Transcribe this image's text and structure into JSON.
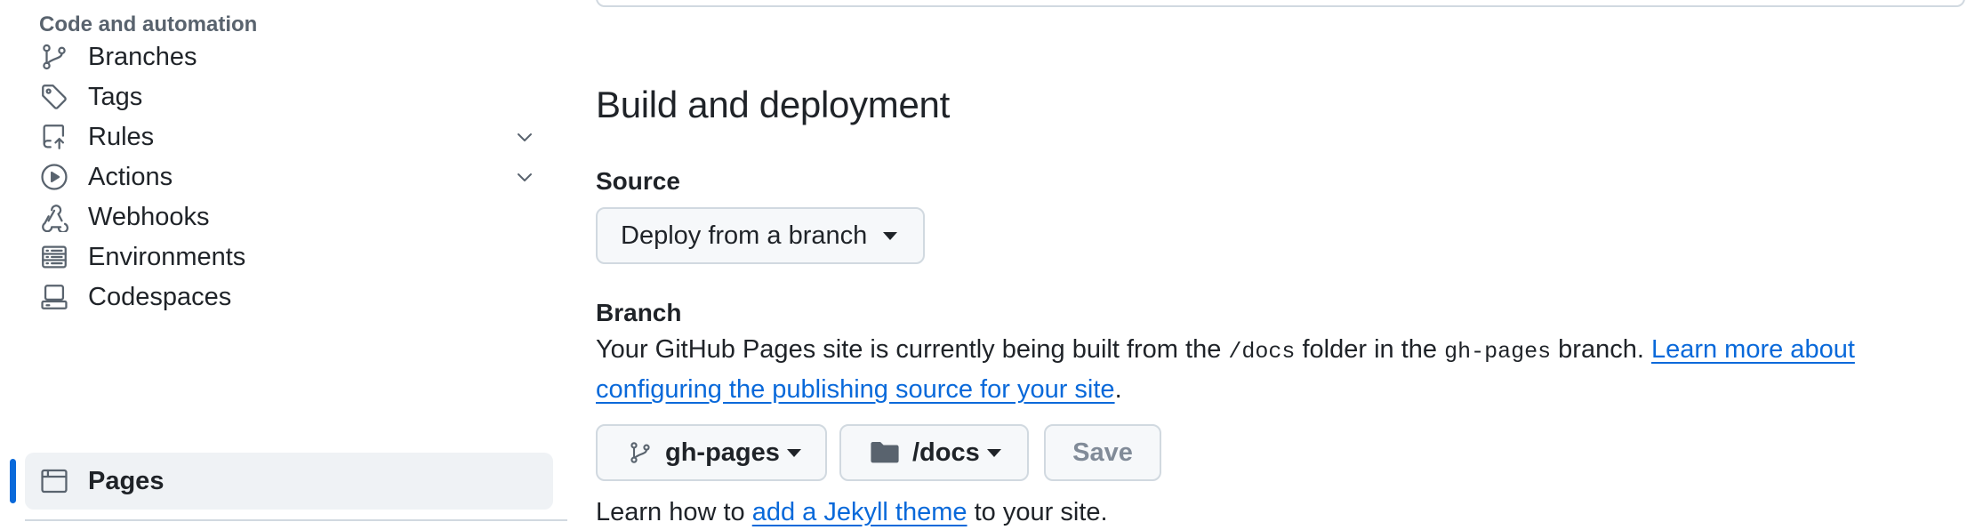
{
  "sidebar": {
    "heading": "Code and automation",
    "items": [
      {
        "label": "Branches",
        "icon": "git-branch-icon"
      },
      {
        "label": "Tags",
        "icon": "tag-icon"
      },
      {
        "label": "Rules",
        "icon": "repo-push-icon",
        "expandable": true
      },
      {
        "label": "Actions",
        "icon": "play-icon",
        "expandable": true
      },
      {
        "label": "Webhooks",
        "icon": "webhook-icon"
      },
      {
        "label": "Environments",
        "icon": "server-icon"
      },
      {
        "label": "Codespaces",
        "icon": "codespaces-icon"
      },
      {
        "label": "Pages",
        "icon": "browser-icon",
        "active": true
      }
    ]
  },
  "main": {
    "section_title": "Build and deployment",
    "source": {
      "label": "Source",
      "dropdown_value": "Deploy from a branch"
    },
    "branch": {
      "label": "Branch",
      "description_prefix": "Your GitHub Pages site is currently being built from the ",
      "folder": "/docs",
      "description_middle": " folder in the ",
      "branch_name": "gh-pages",
      "description_suffix": " branch. ",
      "learn_more_link": "Learn more about configuring the publishing source for your site",
      "period": ".",
      "branch_button": "gh-pages",
      "folder_button": "/docs",
      "save_button": "Save"
    },
    "jekyll": {
      "prefix": "Learn how to ",
      "link": "add a Jekyll theme",
      "suffix": " to your site."
    }
  },
  "colors": {
    "accent": "#0969da",
    "text": "#1f2328",
    "muted": "#59636e",
    "border": "#d1d9e0",
    "active_bg": "#eff2f5"
  }
}
